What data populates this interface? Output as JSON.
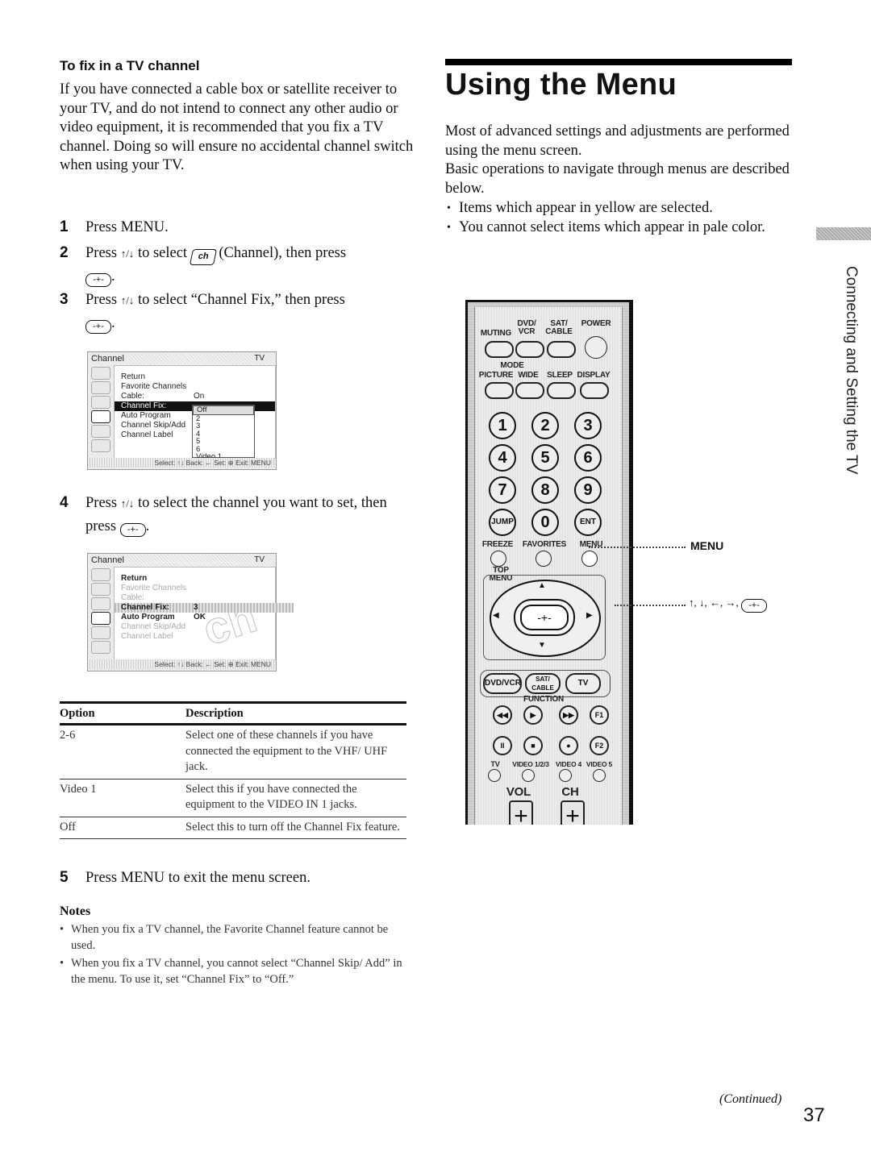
{
  "left": {
    "heading": "To fix in a TV channel",
    "intro": "If you have connected a cable box or satellite receiver to your TV, and do not intend to connect any other audio or video equipment, it is recommended that you fix a TV channel. Doing so will ensure no accidental channel switch when using your TV.",
    "steps": [
      {
        "num": "1",
        "text": "Press MENU."
      },
      {
        "num": "2",
        "text_before": "Press",
        "arrows": "↑/↓",
        "text_mid": "to select",
        "icon_label": "ch",
        "text_after": "(Channel), then press",
        "enter_symbol": "-+-",
        "end": "."
      },
      {
        "num": "3",
        "text_before": "Press",
        "arrows": "↑/↓",
        "text_after": "to select “Channel Fix,” then press",
        "enter_symbol": "-+-",
        "end": "."
      },
      {
        "num": "4",
        "text_before": "Press",
        "arrows": "↑/↓",
        "text_after": "to select the channel you want to set, then press",
        "enter_symbol": "-+-",
        "end": "."
      },
      {
        "num": "5",
        "text": "Press MENU to exit the menu screen."
      }
    ],
    "osd1": {
      "title": "Channel",
      "source": "TV",
      "items": [
        "Return",
        "Favorite Channels",
        "Cable:",
        "Channel Fix:",
        "Auto Program",
        "Channel Skip/Add",
        "Channel Label"
      ],
      "cable_value": "On",
      "selected_item": "Channel Fix:",
      "dropdown_options": [
        "Off",
        "2",
        "3",
        "4",
        "5",
        "6",
        "Video 1"
      ],
      "dropdown_selected": "Off",
      "footer": "Select: ↑↓  Back: ←  Set: ⊕  Exit: MENU"
    },
    "osd2": {
      "title": "Channel",
      "source": "TV",
      "items": [
        "Return",
        "Favorite Channels",
        "Cable:",
        "Channel Fix:",
        "Auto Program",
        "Channel Skip/Add",
        "Channel Label"
      ],
      "channel_fix_value": "3",
      "auto_program_value": "OK",
      "watermark": "ch",
      "footer": "Select: ↑↓  Back: ←  Set: ⊕  Exit: MENU"
    },
    "table": {
      "headers": [
        "Option",
        "Description"
      ],
      "rows": [
        {
          "option": "2-6",
          "description": "Select one of these channels if you have connected the equipment to the VHF/ UHF jack."
        },
        {
          "option": "Video 1",
          "description": "Select this if you have connected the equipment to the VIDEO IN 1 jacks."
        },
        {
          "option": "Off",
          "description": "Select this to turn off the Channel Fix feature."
        }
      ]
    },
    "notes": {
      "title": "Notes",
      "items": [
        "When you fix a TV channel, the Favorite Channel feature cannot be used.",
        "When you fix a TV channel, you cannot select “Channel Skip/ Add” in the menu. To use it, set “Channel Fix” to “Off.”"
      ]
    }
  },
  "right": {
    "title": "Using the Menu",
    "intro_1": "Most of advanced settings and adjustments are performed using the menu screen.",
    "intro_2": "Basic operations to navigate through menus are described below.",
    "bullets": [
      "Items which appear in yellow are selected.",
      "You cannot select items which appear in pale color."
    ],
    "remote": {
      "row1_labels": [
        "MUTING",
        "DVD/ VCR",
        "SAT/ CABLE",
        "POWER"
      ],
      "mode_label": "MODE",
      "row2_labels": [
        "PICTURE",
        "WIDE",
        "SLEEP",
        "DISPLAY"
      ],
      "numbers": [
        "1",
        "2",
        "3",
        "4",
        "5",
        "6",
        "7",
        "8",
        "9",
        "JUMP",
        "0",
        "ENT"
      ],
      "row_fav_labels": [
        "FREEZE",
        "FAVORITES",
        "MENU"
      ],
      "top_menu_label": "TOP MENU",
      "dpad": {
        "up": "▲",
        "down": "▼",
        "left": "◀",
        "right": "▶",
        "center": "-+-"
      },
      "function_buttons": [
        "DVD/VCR",
        "SAT/ CABLE",
        "TV"
      ],
      "function_label": "FUNCTION",
      "transport_row1": [
        "◀◀",
        "▶",
        "▶▶",
        "F1"
      ],
      "transport_row2": [
        "II",
        "■",
        "●",
        "F2"
      ],
      "input_labels": [
        "TV",
        "VIDEO 1/2/3",
        "VIDEO 4",
        "VIDEO 5"
      ],
      "vol_label": "VOL",
      "ch_label": "CH",
      "plus": "+"
    },
    "callouts": {
      "menu": "MENU",
      "arrows": "↑, ↓, ←, →,",
      "enter_symbol": "-+-"
    }
  },
  "side_tab": "Connecting and Setting the TV",
  "footer": {
    "continued": "(Continued)",
    "page_number": "37"
  }
}
